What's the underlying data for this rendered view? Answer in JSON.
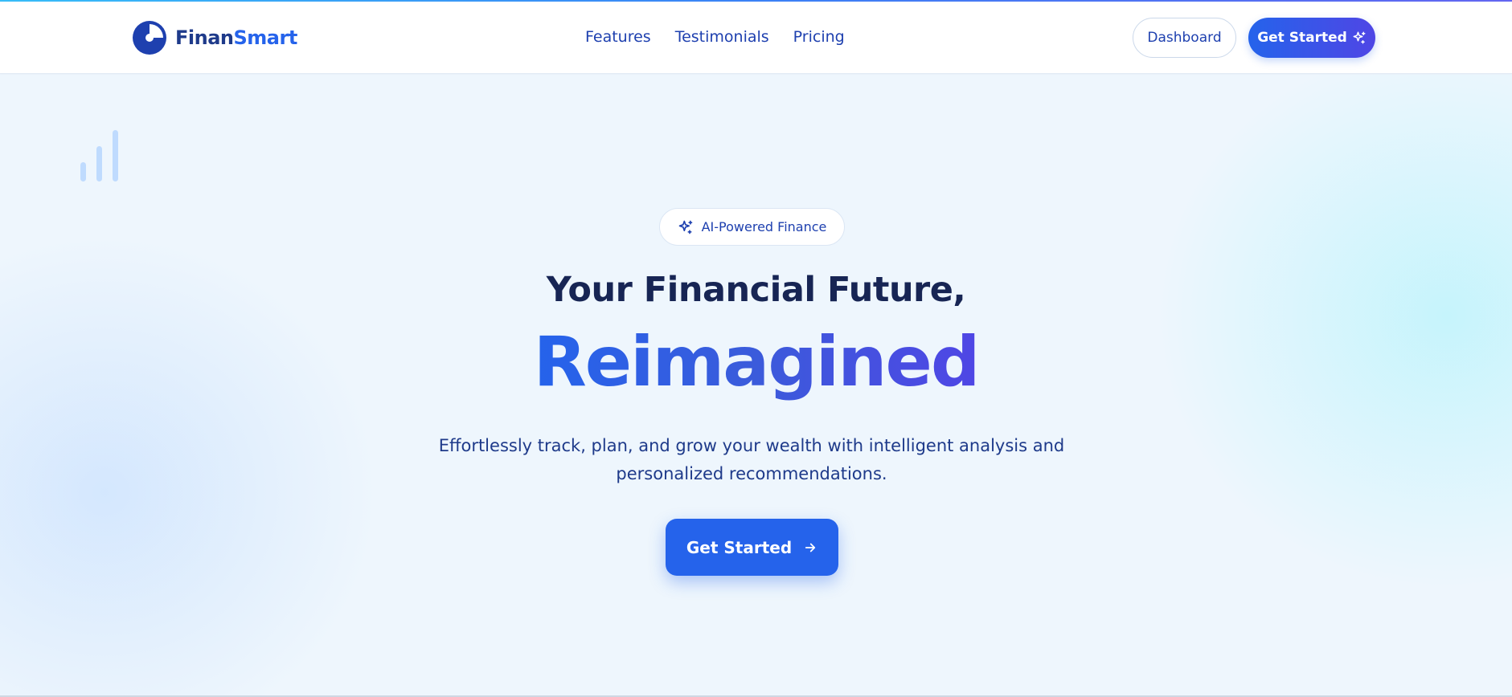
{
  "brand": {
    "name_part1": "Finan",
    "name_part2": "Smart",
    "logo_icon": "pie-chart-icon"
  },
  "nav": {
    "links": [
      {
        "label": "Features"
      },
      {
        "label": "Testimonials"
      },
      {
        "label": "Pricing"
      }
    ]
  },
  "header_actions": {
    "dashboard_label": "Dashboard",
    "get_started_label": "Get Started",
    "get_started_icon": "sparkles-icon"
  },
  "hero": {
    "badge_label": "AI-Powered Finance",
    "badge_icon": "sparkles-icon",
    "headline": "Your Financial Future,",
    "headline_accent": "Reimagined",
    "description": "Effortlessly track, plan, and grow your wealth with intelligent analysis and personalized recommendations.",
    "cta_label": "Get Started",
    "cta_icon": "arrow-right-icon",
    "decoration_icon": "bar-chart-icon"
  },
  "colors": {
    "primary": "#2563eb",
    "accent": "#4f46e5",
    "dark_navy": "#172554",
    "background": "#eef6fd"
  }
}
